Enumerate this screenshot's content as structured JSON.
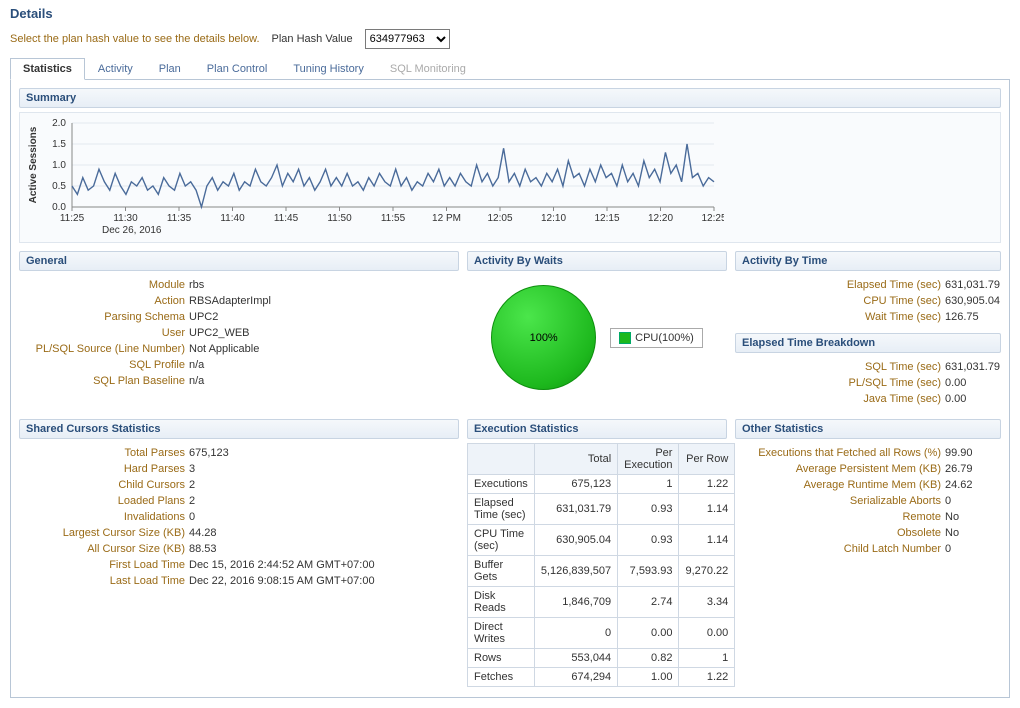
{
  "title": "Details",
  "hashRow": {
    "hint": "Select the plan hash value to see the details below.",
    "label": "Plan Hash Value",
    "value": "634977963"
  },
  "tabs": [
    "Statistics",
    "Activity",
    "Plan",
    "Plan Control",
    "Tuning History",
    "SQL Monitoring"
  ],
  "summary": {
    "header": "Summary",
    "yLabel": "Active Sessions",
    "dateLabel": "Dec 26, 2016"
  },
  "general": {
    "header": "General",
    "items": [
      {
        "k": "Module",
        "v": "rbs"
      },
      {
        "k": "Action",
        "v": "RBSAdapterImpl"
      },
      {
        "k": "Parsing Schema",
        "v": "UPC2"
      },
      {
        "k": "User",
        "v": "UPC2_WEB"
      },
      {
        "k": "PL/SQL Source (Line Number)",
        "v": "Not Applicable"
      },
      {
        "k": "SQL Profile",
        "v": "n/a"
      },
      {
        "k": "SQL Plan Baseline",
        "v": "n/a"
      }
    ]
  },
  "activityWaits": {
    "header": "Activity By Waits",
    "slice": "100%",
    "legend": "CPU(100%)"
  },
  "activityTime": {
    "header": "Activity By Time",
    "items": [
      {
        "k": "Elapsed Time (sec)",
        "v": "631,031.79"
      },
      {
        "k": "CPU Time (sec)",
        "v": "630,905.04"
      },
      {
        "k": "Wait Time (sec)",
        "v": "126.75"
      }
    ]
  },
  "elapsedBreakdown": {
    "header": "Elapsed Time Breakdown",
    "items": [
      {
        "k": "SQL Time (sec)",
        "v": "631,031.79"
      },
      {
        "k": "PL/SQL Time (sec)",
        "v": "0.00"
      },
      {
        "k": "Java Time (sec)",
        "v": "0.00"
      }
    ]
  },
  "sharedCursors": {
    "header": "Shared Cursors Statistics",
    "items": [
      {
        "k": "Total Parses",
        "v": "675,123"
      },
      {
        "k": "Hard Parses",
        "v": "3"
      },
      {
        "k": "Child Cursors",
        "v": "2"
      },
      {
        "k": "Loaded Plans",
        "v": "2"
      },
      {
        "k": "Invalidations",
        "v": "0"
      },
      {
        "k": "Largest Cursor Size (KB)",
        "v": "44.28"
      },
      {
        "k": "All Cursor Size (KB)",
        "v": "88.53"
      },
      {
        "k": "First Load Time",
        "v": "Dec 15, 2016 2:44:52 AM GMT+07:00"
      },
      {
        "k": "Last Load Time",
        "v": "Dec 22, 2016 9:08:15 AM GMT+07:00"
      }
    ]
  },
  "execStats": {
    "header": "Execution Statistics",
    "cols": [
      "",
      "Total",
      "Per Execution",
      "Per Row"
    ],
    "rows": [
      [
        "Executions",
        "675,123",
        "1",
        "1.22"
      ],
      [
        "Elapsed Time (sec)",
        "631,031.79",
        "0.93",
        "1.14"
      ],
      [
        "CPU Time (sec)",
        "630,905.04",
        "0.93",
        "1.14"
      ],
      [
        "Buffer Gets",
        "5,126,839,507",
        "7,593.93",
        "9,270.22"
      ],
      [
        "Disk Reads",
        "1,846,709",
        "2.74",
        "3.34"
      ],
      [
        "Direct Writes",
        "0",
        "0.00",
        "0.00"
      ],
      [
        "Rows",
        "553,044",
        "0.82",
        "1"
      ],
      [
        "Fetches",
        "674,294",
        "1.00",
        "1.22"
      ]
    ]
  },
  "otherStats": {
    "header": "Other Statistics",
    "items": [
      {
        "k": "Executions that Fetched all Rows (%)",
        "v": "99.90"
      },
      {
        "k": "Average Persistent Mem (KB)",
        "v": "26.79"
      },
      {
        "k": "Average Runtime Mem (KB)",
        "v": "24.62"
      },
      {
        "k": "Serializable Aborts",
        "v": "0"
      },
      {
        "k": "Remote",
        "v": "No"
      },
      {
        "k": "Obsolete",
        "v": "No"
      },
      {
        "k": "Child Latch Number",
        "v": "0"
      }
    ]
  },
  "chart_data": {
    "type": "line",
    "title": "Active Sessions",
    "xlabel": "",
    "ylabel": "Active Sessions",
    "ylim": [
      0,
      2.0
    ],
    "yticks": [
      0.0,
      0.5,
      1.0,
      1.5,
      2.0
    ],
    "xticks": [
      "11:25",
      "11:30",
      "11:35",
      "11:40",
      "11:45",
      "11:50",
      "11:55",
      "12 PM",
      "12:05",
      "12:10",
      "12:15",
      "12:20",
      "12:25"
    ],
    "x": [
      0,
      1,
      2,
      3,
      4,
      5,
      6,
      7,
      8,
      9,
      10,
      11,
      12,
      13,
      14,
      15,
      16,
      17,
      18,
      19,
      20,
      21,
      22,
      23,
      24,
      25,
      26,
      27,
      28,
      29,
      30,
      31,
      32,
      33,
      34,
      35,
      36,
      37,
      38,
      39,
      40,
      41,
      42,
      43,
      44,
      45,
      46,
      47,
      48,
      49,
      50,
      51,
      52,
      53,
      54,
      55,
      56,
      57,
      58,
      59,
      60,
      61,
      62,
      63,
      64,
      65,
      66,
      67,
      68,
      69,
      70,
      71,
      72,
      73,
      74,
      75,
      76,
      77,
      78,
      79,
      80,
      81,
      82,
      83,
      84,
      85,
      86,
      87,
      88,
      89,
      90,
      91,
      92,
      93,
      94,
      95,
      96,
      97,
      98,
      99,
      100,
      101,
      102,
      103,
      104,
      105,
      106,
      107,
      108,
      109,
      110,
      111,
      112,
      113,
      114,
      115,
      116,
      117,
      118,
      119
    ],
    "values": [
      0.5,
      0.3,
      0.7,
      0.4,
      0.5,
      0.9,
      0.6,
      0.4,
      0.8,
      0.5,
      0.3,
      0.6,
      0.5,
      0.7,
      0.4,
      0.5,
      0.3,
      0.7,
      0.5,
      0.4,
      0.8,
      0.5,
      0.6,
      0.4,
      0.0,
      0.5,
      0.7,
      0.4,
      0.6,
      0.5,
      0.8,
      0.4,
      0.6,
      0.5,
      0.9,
      0.6,
      0.5,
      0.7,
      1.0,
      0.5,
      0.8,
      0.6,
      0.9,
      0.5,
      0.7,
      0.4,
      0.6,
      0.9,
      0.5,
      0.7,
      0.5,
      0.8,
      0.5,
      0.6,
      0.4,
      0.7,
      0.5,
      0.8,
      0.6,
      0.5,
      0.9,
      0.5,
      0.7,
      0.4,
      0.6,
      0.5,
      0.8,
      0.6,
      0.9,
      0.5,
      0.7,
      0.5,
      0.8,
      0.6,
      0.5,
      1.0,
      0.6,
      0.8,
      0.5,
      0.7,
      1.4,
      0.6,
      0.8,
      0.5,
      0.9,
      0.6,
      0.7,
      0.5,
      0.8,
      0.6,
      0.9,
      0.5,
      1.1,
      0.7,
      0.8,
      0.5,
      0.9,
      0.6,
      1.0,
      0.7,
      0.8,
      0.5,
      1.0,
      0.6,
      0.8,
      0.5,
      1.1,
      0.7,
      0.9,
      0.6,
      1.3,
      0.8,
      1.0,
      0.6,
      1.5,
      0.7,
      0.8,
      0.5,
      0.7,
      0.6
    ]
  }
}
